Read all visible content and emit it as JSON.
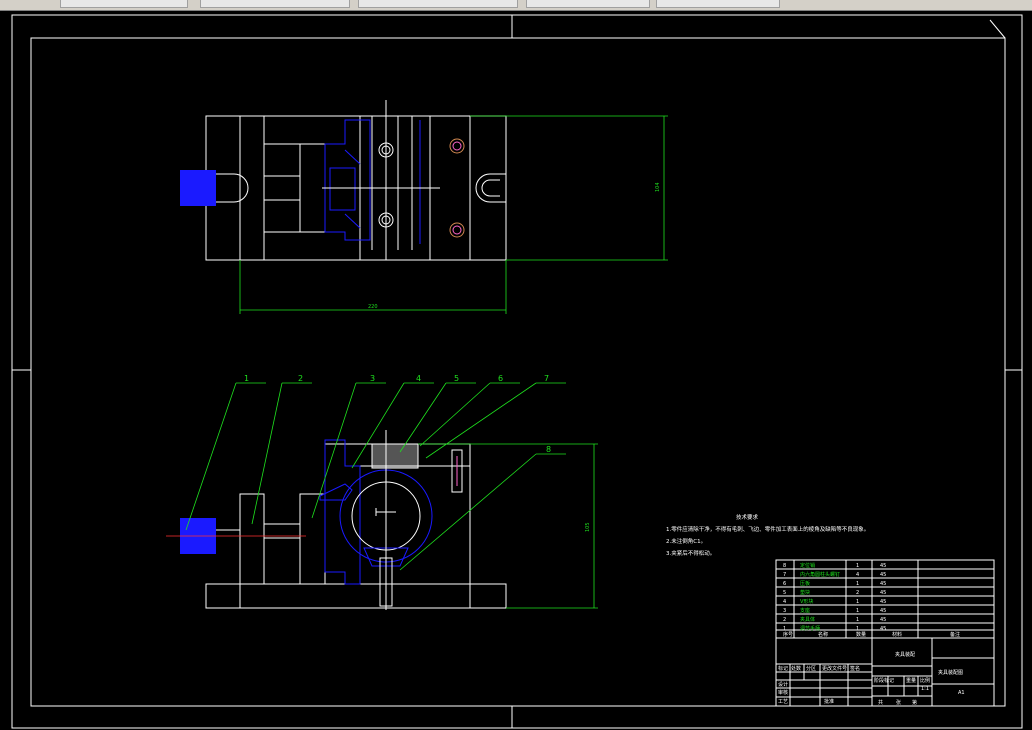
{
  "tabs": [
    "",
    "",
    "",
    "",
    ""
  ],
  "colors": {
    "bg": "#000000",
    "line": "#ffffff",
    "dim": "#1ee21e",
    "part": "#1a1aff",
    "center": "#ff3030",
    "bolt": "#ff66cc"
  },
  "dims": {
    "top_width": "220",
    "top_height": "104",
    "front_height": "105"
  },
  "balloons": [
    "1",
    "2",
    "3",
    "4",
    "5",
    "6",
    "7",
    "8"
  ],
  "notes": {
    "title": "技术要求",
    "lines": [
      "1.零件应清除干净，不得有毛刺、飞边、零件加工表面上的棱角及缺陷等不良现象。",
      "2.未注倒角C1。",
      "3.夹紧后不得松动。"
    ]
  },
  "bom": {
    "rows": [
      [
        "8",
        "定位销",
        "1",
        "45"
      ],
      [
        "7",
        "内六角圆柱头螺钉",
        "4",
        "45"
      ],
      [
        "6",
        "压板",
        "1",
        "45"
      ],
      [
        "5",
        "垫块",
        "2",
        "45"
      ],
      [
        "4",
        "V形块",
        "1",
        "45"
      ],
      [
        "3",
        "支座",
        "1",
        "45"
      ],
      [
        "2",
        "夹具体",
        "1",
        "45"
      ],
      [
        "1",
        "调节手柄",
        "1",
        "45"
      ]
    ],
    "header": [
      "序号",
      "名称",
      "数量",
      "材料",
      "备注"
    ]
  },
  "title_block": {
    "drawing_name": "夹具装配",
    "part_name": "夹具装配图",
    "scale": "1:1",
    "sheet": "A1",
    "labels": [
      "设计",
      "审核",
      "工艺",
      "批准",
      "标记",
      "处数",
      "分区",
      "更改文件号",
      "签名",
      "年月日",
      "阶段标记",
      "重量",
      "比例",
      "共",
      "张",
      "第"
    ]
  }
}
